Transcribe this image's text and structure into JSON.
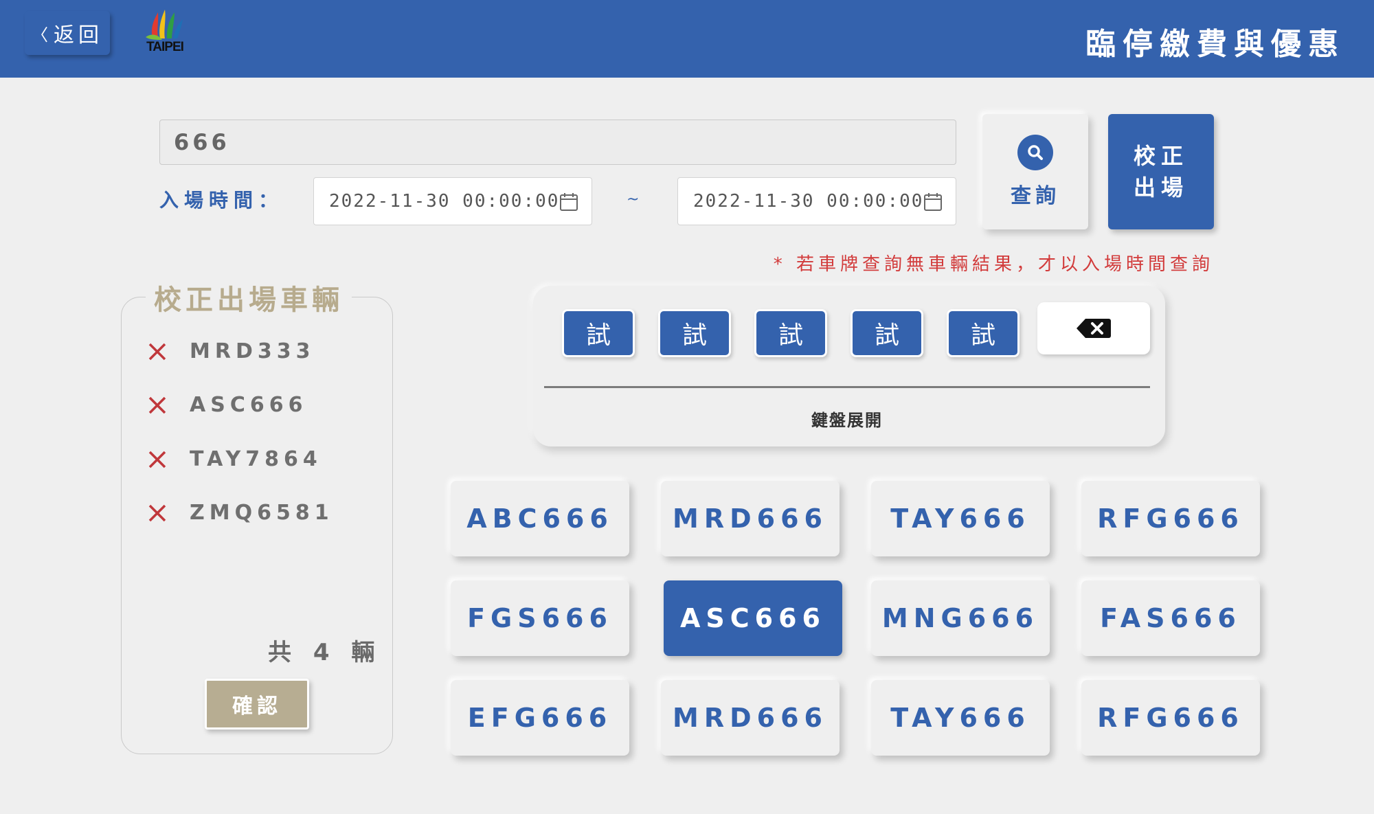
{
  "header": {
    "back_label": "返回",
    "logo_text": "TAIPEI",
    "title": "臨停繳費與優惠",
    "background": "#3462ad"
  },
  "search": {
    "plate_value": "666",
    "time_label": "入場時間：",
    "start_time": "2022-11-30 00:00:00",
    "end_time": "2022-11-30 00:00:00",
    "range_separator": "~",
    "query_label": "查詢",
    "correct_exit_line1": "校正",
    "correct_exit_line2": "出場",
    "note": "* 若車牌查詢無車輛結果，才以入場時間查詢"
  },
  "corrected_panel": {
    "title": "校正出場車輛",
    "vehicles": [
      "MRD333",
      "ASC666",
      "TAY7864",
      "ZMQ6581"
    ],
    "total": "共 4 輛",
    "confirm_label": "確認"
  },
  "keyboard": {
    "keys": [
      "試",
      "試",
      "試",
      "試",
      "試"
    ],
    "delete_icon": "backspace-icon",
    "expand_label": "鍵盤展開"
  },
  "results": {
    "plates": [
      "ABC666",
      "MRD666",
      "TAY666",
      "RFG666",
      "FGS666",
      "ASC666",
      "MNG666",
      "FAS666",
      "EFG666",
      "MRD666",
      "TAY666",
      "RFG666"
    ],
    "selected": "ASC666"
  },
  "colors": {
    "primary": "#3462ad",
    "accent_gold": "#b7ab8d",
    "alert_red": "#d23b3b",
    "background": "#efefef"
  }
}
